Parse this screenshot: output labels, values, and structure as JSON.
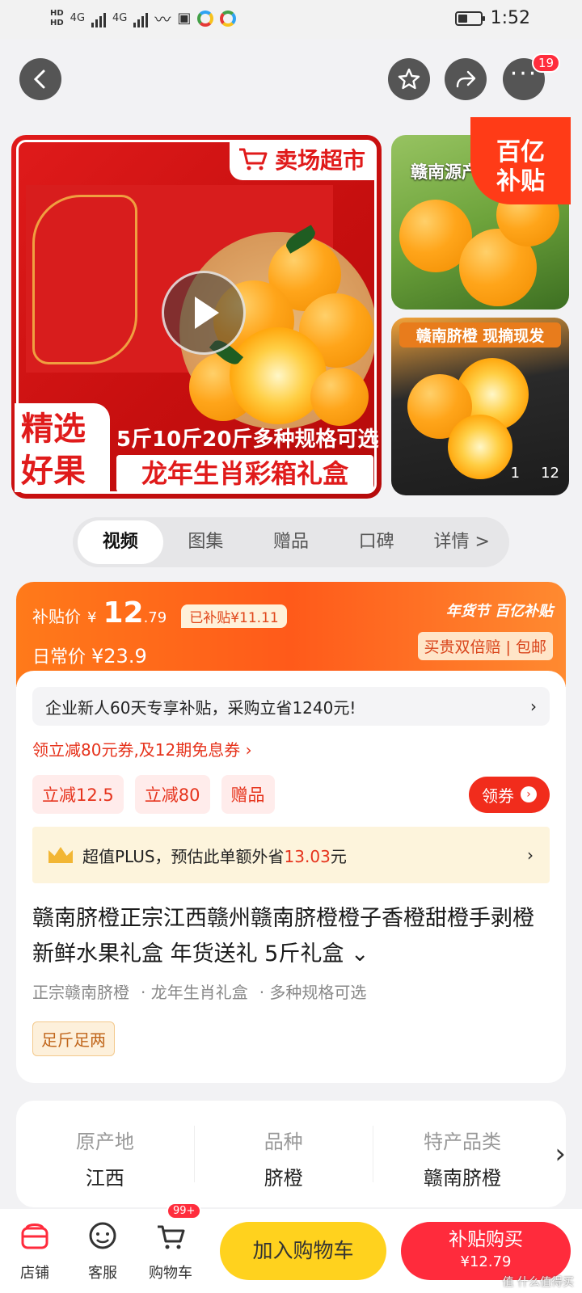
{
  "status_bar": {
    "hd1": "HD",
    "hd2": "HD",
    "net1": "4G",
    "net2": "4G",
    "time": "1:52",
    "battery_level": 0.45
  },
  "nav": {
    "more_badge": "19"
  },
  "gallery": {
    "main_tag": "卖场超市",
    "pick_line1": "精选",
    "pick_line2": "好果",
    "spec_line": "5斤10斤20斤多种规格可选",
    "box_line": "龙年生肖彩箱礼盒",
    "thumb1_text": "赣南源产",
    "thumb2_text": "赣南脐橙 现摘现发",
    "subsidy_tag_line1": "百亿",
    "subsidy_tag_line2": "补贴",
    "counter_current": "1",
    "counter_total": "12"
  },
  "tabs": [
    {
      "label": "视频",
      "active": true
    },
    {
      "label": "图集",
      "active": false
    },
    {
      "label": "赠品",
      "active": false
    },
    {
      "label": "口碑",
      "active": false
    },
    {
      "label": "详情 >",
      "active": false
    }
  ],
  "price": {
    "subsidy_label": "补贴价",
    "currency": "¥",
    "price_int": "12",
    "price_dec": ".79",
    "subsidized_amount": "已补贴¥11.11",
    "daily_label": "日常价",
    "daily_price": "¥23.9",
    "brand_right": "年货节 百亿补贴",
    "guarantee": "买贵双倍赔 | 包邮"
  },
  "promo": {
    "newbie_text": "企业新人60天专享补贴，采购立省1240元!",
    "coupon_link": "领立减80元券,及12期免息券 ›",
    "chips": [
      "立减12.5",
      "立减80",
      "赠品"
    ],
    "get_coupon": "领券",
    "plus_label": "超值PLUS，预估此单额外省",
    "plus_amount": "13.03",
    "plus_unit": "元"
  },
  "product": {
    "title": "赣南脐橙正宗江西赣州赣南脐橙橙子香橙甜橙手剥橙 新鲜水果礼盒 年货送礼 5斤礼盒 ⌄",
    "features": [
      "正宗赣南脐橙",
      "· 龙年生肖礼盒",
      "· 多种规格可选"
    ],
    "weight_tag": "足斤足两"
  },
  "attributes": [
    {
      "key": "原产地",
      "value": "江西"
    },
    {
      "key": "品种",
      "value": "脐橙"
    },
    {
      "key": "特产品类",
      "value": "赣南脐橙"
    }
  ],
  "bottom_bar": {
    "store": "店铺",
    "service": "客服",
    "cart": "购物车",
    "cart_badge": "99+",
    "add_to_cart": "加入购物车",
    "buy_now": "补贴购买",
    "buy_price": "¥12.79",
    "watermark": "值 什么值得买"
  },
  "colors": {
    "accent_red": "#ff2b3c",
    "orange": "#ff6a1a",
    "yellow_btn": "#ffd21e"
  }
}
